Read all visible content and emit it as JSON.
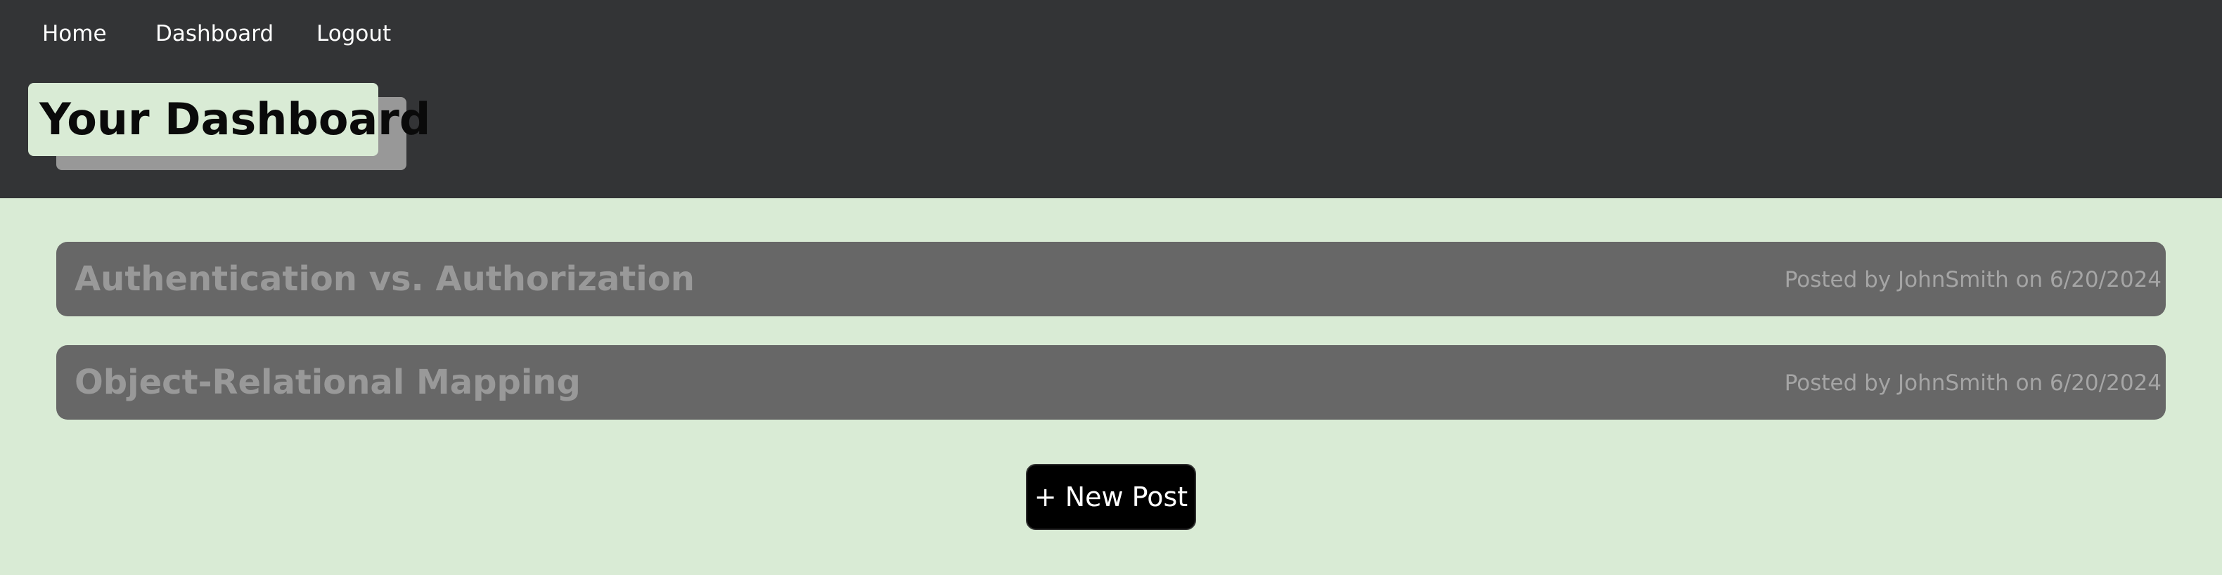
{
  "nav": {
    "items": [
      {
        "label": "Home"
      },
      {
        "label": "Dashboard"
      },
      {
        "label": "Logout"
      }
    ]
  },
  "header": {
    "title": "Your Dashboard"
  },
  "posts": [
    {
      "title": "Authentication vs. Authorization",
      "meta": "Posted by JohnSmith on 6/20/2024"
    },
    {
      "title": "Object-Relational Mapping",
      "meta": "Posted by JohnSmith on 6/20/2024"
    }
  ],
  "actions": {
    "new_post_label": "+ New Post"
  },
  "colors": {
    "header_bg": "#333436",
    "page_bg": "#d9ebd5",
    "post_bg": "#676767",
    "post_text": "#999999",
    "button_bg": "#000000"
  }
}
